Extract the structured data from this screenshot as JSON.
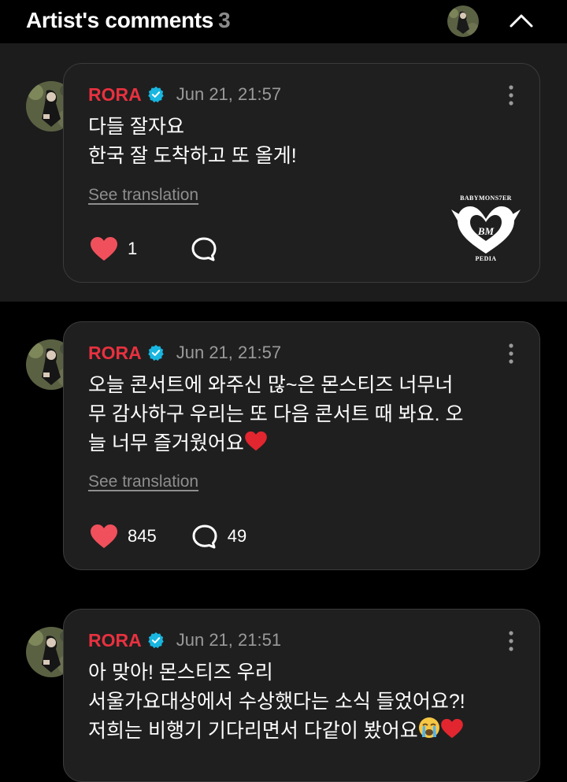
{
  "header": {
    "title": "Artist's comments",
    "count": "3"
  },
  "comments": [
    {
      "author": "RORA",
      "date": "Jun 21, 21:57",
      "text": "다들 잘자요\n한국 잘 도착하고 또 올게!",
      "see_translation": "See translation",
      "likes": "1",
      "replies": "",
      "image_text_top": "BABYMONS7ER",
      "image_text_bottom": "PEDIA"
    },
    {
      "author": "RORA",
      "date": "Jun 21, 21:57",
      "text": "오늘 콘서트에 와주신 많~은 몬스티즈 너무너\n무 감사하구 우리는 또 다음 콘서트 때 봐요. 오\n늘 너무 즐거웠어요",
      "see_translation": "See translation",
      "likes": "845",
      "replies": "49"
    },
    {
      "author": "RORA",
      "date": "Jun 21, 21:51",
      "text": "아 맞아! 몬스티즈 우리\n서울가요대상에서 수상했다는 소식 들었어요?!\n저희는 비행기 기다리면서 다같이 봤어요"
    }
  ],
  "colors": {
    "accent_name": "#e8313f",
    "heart": "#f0505c",
    "verified": "#18b6e0",
    "card_bg": "#1f1f1f",
    "pinned_bg": "#1c1c1c"
  },
  "icons": [
    "chevron-up-icon",
    "verified-icon",
    "more-vertical-icon",
    "heart-icon",
    "comment-bubble-icon",
    "red-heart-emoji",
    "crying-face-emoji"
  ]
}
